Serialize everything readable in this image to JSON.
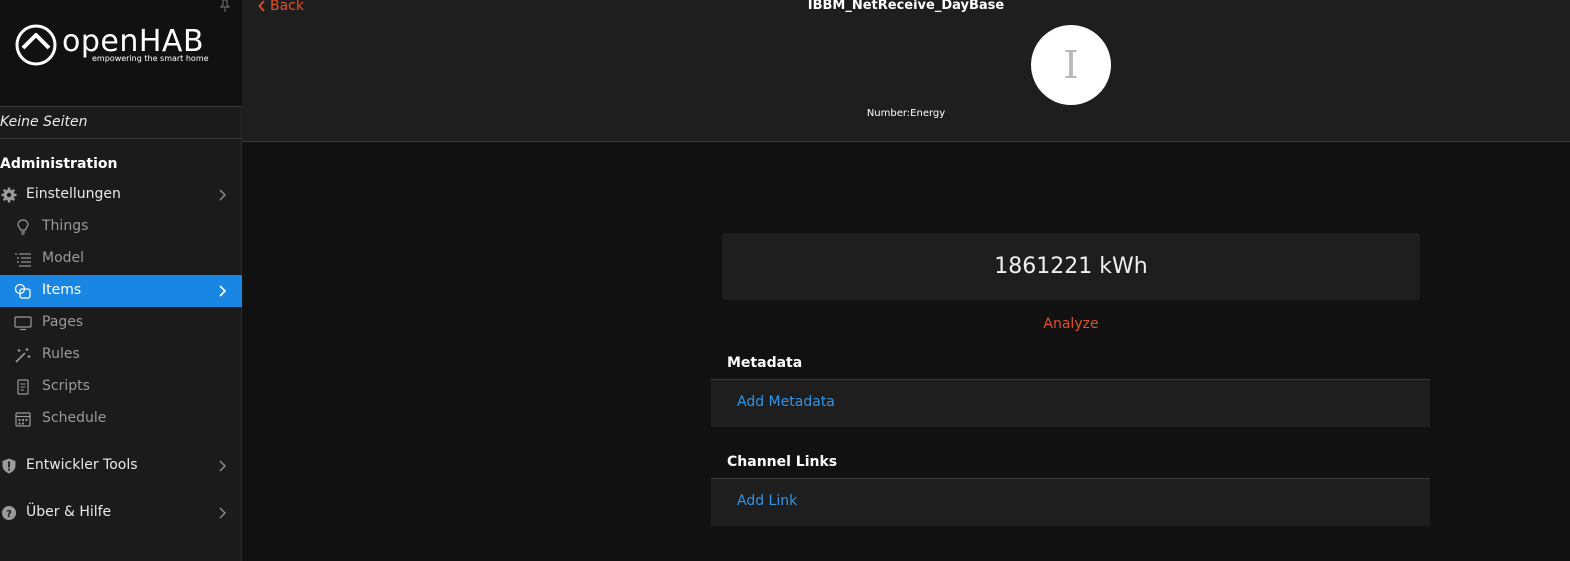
{
  "sidebar": {
    "logo": {
      "text": "openHAB",
      "tagline": "empowering the smart home"
    },
    "no_pages": "Keine Seiten",
    "section_title": "Administration",
    "settings": {
      "label": "Einstellungen",
      "icon": "gear-icon"
    },
    "items": [
      {
        "label": "Things",
        "icon": "bulb-icon"
      },
      {
        "label": "Model",
        "icon": "list-icon"
      },
      {
        "label": "Items",
        "icon": "items-icon",
        "active": true
      },
      {
        "label": "Pages",
        "icon": "monitor-icon"
      },
      {
        "label": "Rules",
        "icon": "wand-icon"
      },
      {
        "label": "Scripts",
        "icon": "document-icon"
      },
      {
        "label": "Schedule",
        "icon": "calendar-icon"
      }
    ],
    "dev_tools": {
      "label": "Entwickler Tools",
      "icon": "shield-icon"
    },
    "help": {
      "label": "Über & Hilfe",
      "icon": "help-icon"
    }
  },
  "header": {
    "back_label": "Back",
    "item_name": "IBBM_NetReceive_DayBase",
    "avatar_letter": "I",
    "item_type": "Number:Energy"
  },
  "main": {
    "state": "1861221 kWh",
    "analyze_label": "Analyze",
    "metadata": {
      "title": "Metadata",
      "add_label": "Add Metadata"
    },
    "channel_links": {
      "title": "Channel Links",
      "add_label": "Add Link"
    }
  },
  "colors": {
    "accent": "#1a86e3",
    "link": "#2f95e8",
    "orange": "#e0502a",
    "background": "#111111"
  }
}
